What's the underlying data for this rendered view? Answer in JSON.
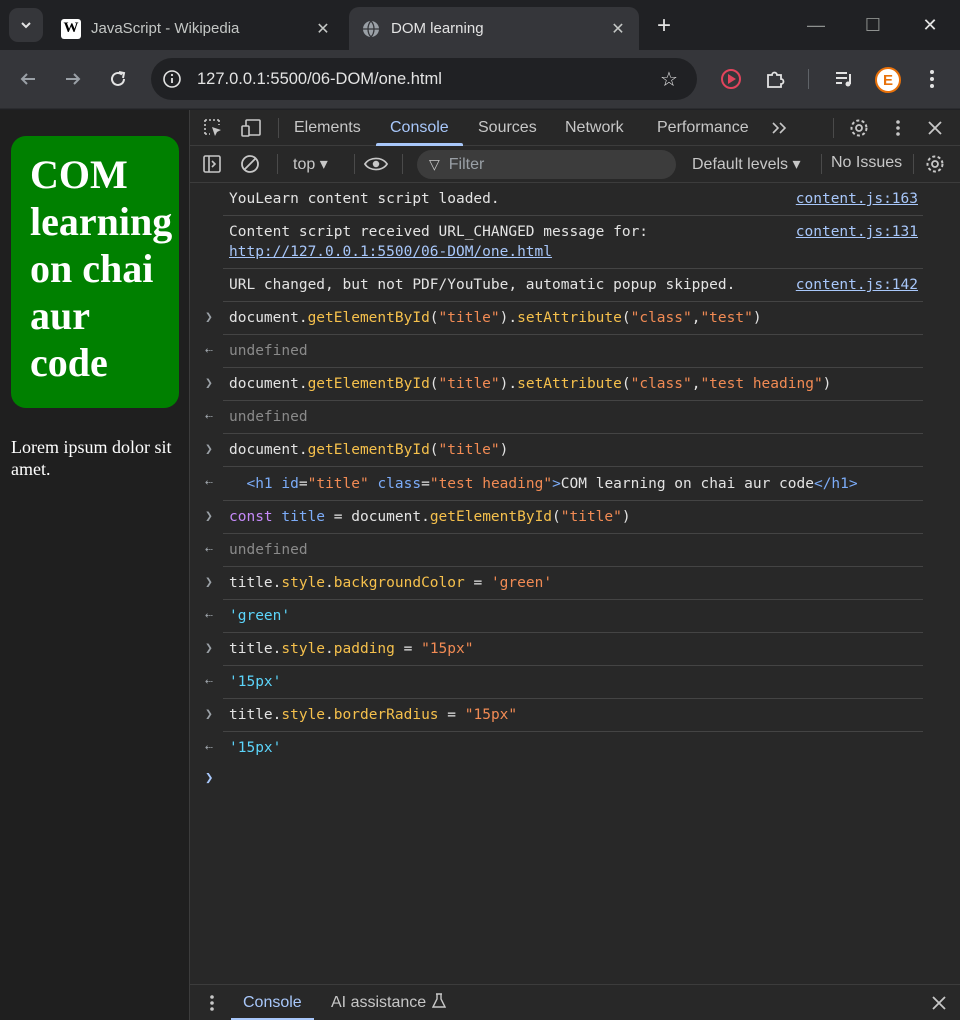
{
  "browser": {
    "tabs": [
      {
        "title": "JavaScript - Wikipedia",
        "favicon": "wikipedia-icon",
        "active": false
      },
      {
        "title": "DOM learning",
        "favicon": "globe-icon",
        "active": true
      }
    ],
    "address": "127.0.0.1:5500/06-DOM/one.html"
  },
  "page": {
    "heading": [
      "COM",
      "learning",
      "on chai",
      "aur",
      "code"
    ],
    "heading_bg": "#008000",
    "paragraph": "Lorem ipsum dolor sit amet."
  },
  "devtools": {
    "tabs": [
      "Elements",
      "Console",
      "Sources",
      "Network",
      "Performance"
    ],
    "active_tab": "Console",
    "context": "top",
    "filter_placeholder": "Filter",
    "levels": "Default levels",
    "issues": "No Issues",
    "console": {
      "log1": {
        "text": "YouLearn content script loaded.",
        "source": "content.js:163"
      },
      "log2": {
        "text": "Content script received URL_CHANGED message for:",
        "link": "http://127.0.0.1:5500/06-DOM/one.html",
        "source": "content.js:131"
      },
      "log3": {
        "text": "URL changed, but not PDF/YouTube, automatic popup skipped.",
        "source": "content.js:142"
      },
      "undefined": "undefined",
      "result_green": "'green'",
      "result_15px": "'15px'"
    },
    "drawer": {
      "tabs": [
        "Console",
        "AI assistance"
      ]
    }
  }
}
